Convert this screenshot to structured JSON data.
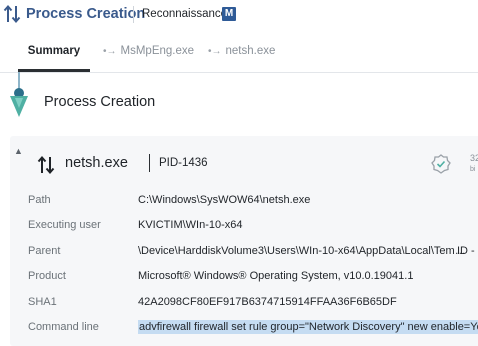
{
  "header": {
    "title": "Process Creation",
    "subtitle": "Reconnaissance",
    "badge_letter": "M"
  },
  "tabs": [
    {
      "label": "Summary",
      "icon": "none",
      "active": true
    },
    {
      "label": "MsMpEng.exe",
      "icon": "dotted-arrow-icon",
      "icon_glyph": "•→"
    },
    {
      "label": "netsh.exe",
      "icon": "dotted-arrow-icon",
      "icon_glyph": "•→"
    }
  ],
  "timeline": {
    "title": "Process Creation",
    "accent_color": "#4fb0a3"
  },
  "process": {
    "name": "netsh.exe",
    "pid": "PID-1436",
    "collapse_glyph": "▲",
    "side_value": "32",
    "side_unit": "bi"
  },
  "details": [
    {
      "label": "Path",
      "value": "C:\\Windows\\SysWOW64\\netsh.exe"
    },
    {
      "label": "Executing user",
      "value": "KVICTIM\\WIn-10-x64"
    },
    {
      "label": "Parent",
      "value": "\\Device\\HarddiskVolume3\\Users\\WIn-10-x64\\AppData\\Local\\Tem…",
      "extra": "ID -"
    },
    {
      "label": "Product",
      "value": "Microsoft® Windows® Operating System, v10.0.19041.1"
    },
    {
      "label": "SHA1",
      "value": "42A2098CF80EF917B6374715914FFAA36F6B65DF"
    },
    {
      "label": "Command line",
      "value": "advfirewall firewall set rule group=\"Network Discovery\" new enable=Yes",
      "highlighted": true
    }
  ],
  "colors": {
    "header_title": "#3a5a8c",
    "mitre_badge": "#2f5b97",
    "highlight": "#c5dcf2",
    "card_bg": "#f6f7f9"
  }
}
